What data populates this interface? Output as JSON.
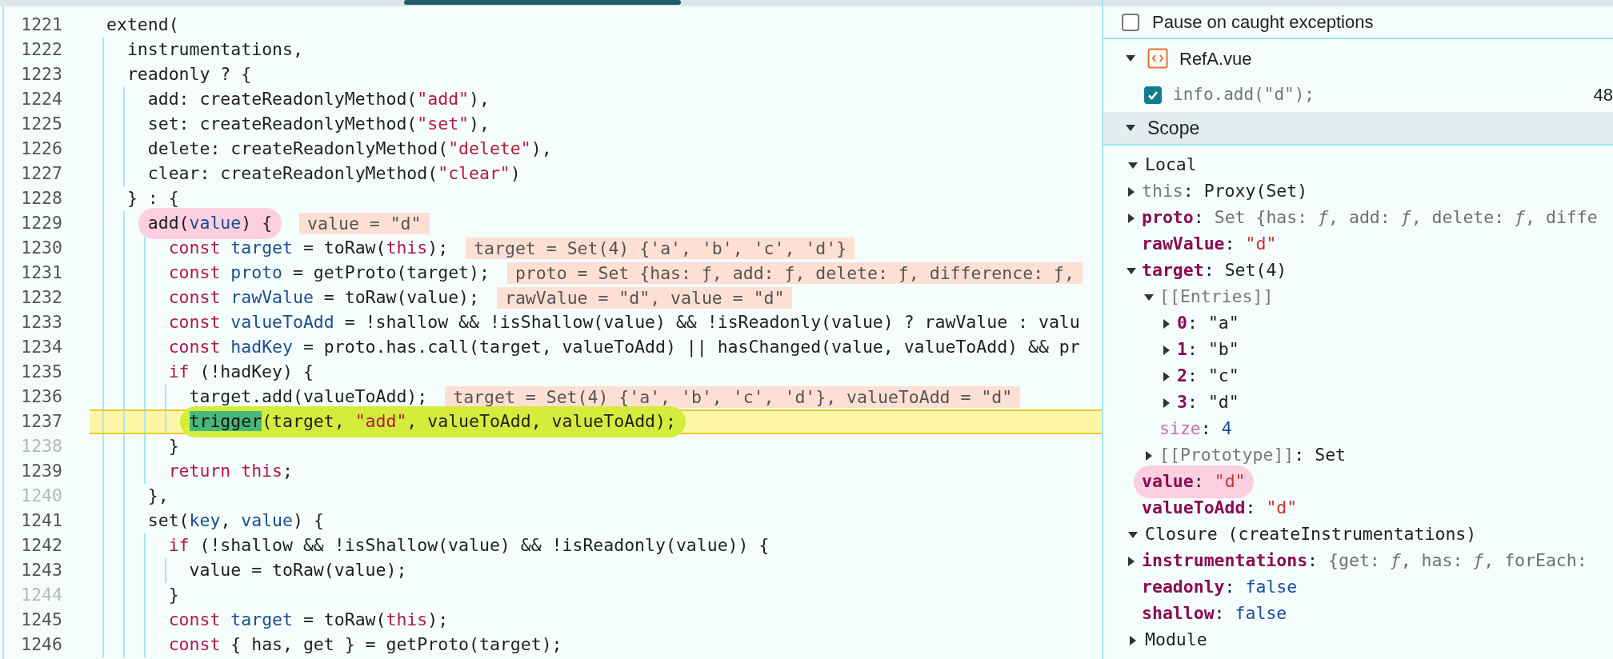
{
  "editor": {
    "lines": [
      {
        "number": "1221",
        "breakable": true,
        "tokens": [
          {
            "kind": "plain",
            "text": "extend("
          }
        ]
      },
      {
        "number": "1222",
        "breakable": true,
        "tokens": [
          {
            "kind": "plain",
            "text": "  instrumentations,"
          }
        ]
      },
      {
        "number": "1223",
        "breakable": true,
        "tokens": [
          {
            "kind": "plain",
            "text": "  readonly ? {"
          }
        ]
      },
      {
        "number": "1224",
        "breakable": true,
        "tokens": [
          {
            "kind": "plain",
            "text": "    add: createReadonlyMethod("
          },
          {
            "kind": "string",
            "text": "\"add\""
          },
          {
            "kind": "plain",
            "text": "),"
          }
        ]
      },
      {
        "number": "1225",
        "breakable": true,
        "tokens": [
          {
            "kind": "plain",
            "text": "    set: createReadonlyMethod("
          },
          {
            "kind": "string",
            "text": "\"set\""
          },
          {
            "kind": "plain",
            "text": "),"
          }
        ]
      },
      {
        "number": "1226",
        "breakable": true,
        "tokens": [
          {
            "kind": "plain",
            "text": "    delete: createReadonlyMethod("
          },
          {
            "kind": "string",
            "text": "\"delete\""
          },
          {
            "kind": "plain",
            "text": "),"
          }
        ]
      },
      {
        "number": "1227",
        "breakable": true,
        "tokens": [
          {
            "kind": "plain",
            "text": "    clear: createReadonlyMethod("
          },
          {
            "kind": "string",
            "text": "\"clear\""
          },
          {
            "kind": "plain",
            "text": ")"
          }
        ]
      },
      {
        "number": "1228",
        "breakable": true,
        "tokens": [
          {
            "kind": "plain",
            "text": "  } : {"
          }
        ]
      },
      {
        "number": "1229",
        "breakable": true,
        "color": "#fbcfe0",
        "inline_value": "value = \"d\"",
        "tokens": [
          {
            "kind": "plain",
            "text": "    add("
          },
          {
            "kind": "variable",
            "text": "value"
          },
          {
            "kind": "plain",
            "text": ") {"
          }
        ]
      },
      {
        "number": "1230",
        "breakable": true,
        "inline_value": "target = Set(4) {'a', 'b', 'c', 'd'}",
        "tokens": [
          {
            "kind": "keyword",
            "text": "      const"
          },
          {
            "kind": "variable",
            "text": " target"
          },
          {
            "kind": "plain",
            "text": " = toRaw("
          },
          {
            "kind": "keyword",
            "text": "this"
          },
          {
            "kind": "plain",
            "text": ");"
          }
        ]
      },
      {
        "number": "1231",
        "breakable": true,
        "inline_value": "proto = Set {has: ƒ, add: ƒ, delete: ƒ, difference: ƒ,",
        "tokens": [
          {
            "kind": "keyword",
            "text": "      const"
          },
          {
            "kind": "variable",
            "text": " proto"
          },
          {
            "kind": "plain",
            "text": " = getProto(target);"
          }
        ]
      },
      {
        "number": "1232",
        "breakable": true,
        "inline_value": "rawValue = \"d\", value = \"d\"",
        "tokens": [
          {
            "kind": "keyword",
            "text": "      const"
          },
          {
            "kind": "variable",
            "text": " rawValue"
          },
          {
            "kind": "plain",
            "text": " = toRaw(value);"
          }
        ]
      },
      {
        "number": "1233",
        "breakable": true,
        "tokens": [
          {
            "kind": "keyword",
            "text": "      const"
          },
          {
            "kind": "variable",
            "text": " valueToAdd"
          },
          {
            "kind": "plain",
            "text": " = !shallow && !isShallow(value) && !isReadonly(value) ? rawValue : valu"
          }
        ]
      },
      {
        "number": "1234",
        "breakable": true,
        "tokens": [
          {
            "kind": "keyword",
            "text": "      const"
          },
          {
            "kind": "variable",
            "text": " hadKey"
          },
          {
            "kind": "plain",
            "text": " = proto.has.call(target, valueToAdd) || hasChanged(value, valueToAdd) && pr"
          }
        ]
      },
      {
        "number": "1235",
        "breakable": true,
        "tokens": [
          {
            "kind": "keyword",
            "text": "      if"
          },
          {
            "kind": "plain",
            "text": " (!hadKey) {"
          }
        ]
      },
      {
        "number": "1236",
        "breakable": true,
        "inline_value": "target = Set(4) {'a', 'b', 'c', 'd'}, valueToAdd = \"d\"",
        "tokens": [
          {
            "kind": "plain",
            "text": "        target.add(valueToAdd);"
          }
        ]
      },
      {
        "number": "1237",
        "breakable": true,
        "current": true,
        "color": "#d4ec3c",
        "tokens": [
          {
            "kind": "paused",
            "text": "        trigger"
          },
          {
            "kind": "plain",
            "text": "(target, "
          },
          {
            "kind": "string",
            "text": "\"add\""
          },
          {
            "kind": "plain",
            "text": ", valueToAdd, valueToAdd);"
          }
        ]
      },
      {
        "number": "1238",
        "breakable": false,
        "tokens": [
          {
            "kind": "plain",
            "text": "      }"
          }
        ]
      },
      {
        "number": "1239",
        "breakable": true,
        "tokens": [
          {
            "kind": "keyword",
            "text": "      return this"
          },
          {
            "kind": "plain",
            "text": ";"
          }
        ]
      },
      {
        "number": "1240",
        "breakable": false,
        "tokens": [
          {
            "kind": "plain",
            "text": "    },"
          }
        ]
      },
      {
        "number": "1241",
        "breakable": true,
        "tokens": [
          {
            "kind": "plain",
            "text": "    set("
          },
          {
            "kind": "variable",
            "text": "key"
          },
          {
            "kind": "plain",
            "text": ", "
          },
          {
            "kind": "variable",
            "text": "value"
          },
          {
            "kind": "plain",
            "text": ") {"
          }
        ]
      },
      {
        "number": "1242",
        "breakable": true,
        "tokens": [
          {
            "kind": "keyword",
            "text": "      if"
          },
          {
            "kind": "plain",
            "text": " (!shallow && !isShallow(value) && !isReadonly(value)) {"
          }
        ]
      },
      {
        "number": "1243",
        "breakable": true,
        "tokens": [
          {
            "kind": "plain",
            "text": "        value = toRaw(value);"
          }
        ]
      },
      {
        "number": "1244",
        "breakable": false,
        "tokens": [
          {
            "kind": "plain",
            "text": "      }"
          }
        ]
      },
      {
        "number": "1245",
        "breakable": true,
        "tokens": [
          {
            "kind": "keyword",
            "text": "      const"
          },
          {
            "kind": "variable",
            "text": " target"
          },
          {
            "kind": "plain",
            "text": " = toRaw("
          },
          {
            "kind": "keyword",
            "text": "this"
          },
          {
            "kind": "plain",
            "text": ");"
          }
        ]
      },
      {
        "number": "1246",
        "breakable": true,
        "tokens": [
          {
            "kind": "keyword",
            "text": "      const"
          },
          {
            "kind": "plain",
            "text": " { has, get } = getProto(target);"
          }
        ]
      }
    ]
  },
  "sidebar": {
    "pause_on_caught": {
      "label": "Pause on caught exceptions",
      "checked": false
    },
    "breakpoint_files": [
      {
        "file": "RefA.vue",
        "expanded": true,
        "breakpoints": [
          {
            "code": "info.add(\"d\");",
            "line": "48",
            "checked": true
          }
        ]
      }
    ],
    "scope": {
      "title": "Scope",
      "expanded": true,
      "sections": [
        {
          "title": "Local",
          "expanded": true,
          "items": [
            {
              "kind": "internal",
              "name": "this:",
              "value": {
                "kind": "object",
                "text": "Proxy(Set)"
              },
              "expanded": false
            },
            {
              "kind": "own",
              "name": "proto:",
              "value": {
                "kind": "preview",
                "text": "Set {has: *ƒ*, add: *ƒ*, delete: *ƒ*, diffe"
              },
              "expanded": false
            },
            {
              "kind": "own",
              "name": "rawValue:",
              "value": {
                "kind": "string",
                "text": "\"d\""
              }
            },
            {
              "kind": "own",
              "name": "target:",
              "value": {
                "kind": "object",
                "text": "Set(4)"
              },
              "expanded": true,
              "children": [
                {
                  "kind": "internal",
                  "name": "[[Entries]]",
                  "expanded": true,
                  "children": [
                    {
                      "kind": "own",
                      "name": "0:",
                      "value": {
                        "kind": "object",
                        "text": "\"a\""
                      },
                      "expanded": false
                    },
                    {
                      "kind": "own",
                      "name": "1:",
                      "value": {
                        "kind": "object",
                        "text": "\"b\""
                      },
                      "expanded": false
                    },
                    {
                      "kind": "own",
                      "name": "2:",
                      "value": {
                        "kind": "object",
                        "text": "\"c\""
                      },
                      "expanded": false
                    },
                    {
                      "kind": "own",
                      "name": "3:",
                      "value": {
                        "kind": "object",
                        "text": "\"d\""
                      },
                      "expanded": false
                    }
                  ]
                },
                {
                  "kind": "accessor",
                  "name": "size:",
                  "value": {
                    "kind": "number",
                    "text": "4"
                  }
                },
                {
                  "kind": "internal",
                  "name": "[[Prototype]]:",
                  "value": {
                    "kind": "object",
                    "text": "Set"
                  },
                  "expanded": false
                }
              ]
            },
            {
              "kind": "own",
              "name": "value:",
              "value": {
                "kind": "string",
                "text": "\"d\""
              },
              "color": "#fbcfe0"
            },
            {
              "kind": "own",
              "name": "valueToAdd:",
              "value": {
                "kind": "string",
                "text": "\"d\""
              }
            }
          ]
        },
        {
          "title": "Closure (createInstrumentations)",
          "expanded": true,
          "items": [
            {
              "kind": "own",
              "name": "instrumentations:",
              "value": {
                "kind": "preview",
                "text": "{get: *ƒ*, has: *ƒ*, forEach:"
              },
              "expanded": false
            },
            {
              "kind": "own",
              "name": "readonly:",
              "value": {
                "kind": "boolean",
                "text": "false"
              }
            },
            {
              "kind": "own",
              "name": "shallow:",
              "value": {
                "kind": "boolean",
                "text": "false"
              }
            }
          ]
        },
        {
          "title": "Module",
          "expanded": false
        }
      ]
    }
  }
}
